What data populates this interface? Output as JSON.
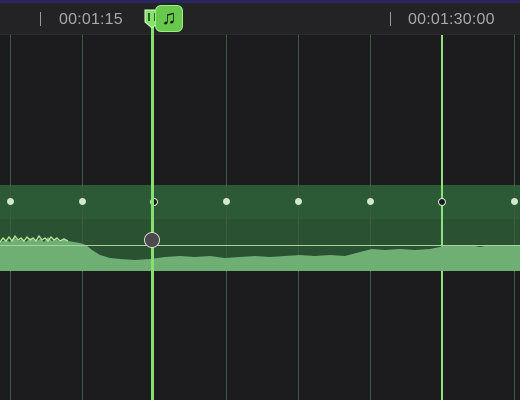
{
  "ruler": {
    "timecodes": [
      {
        "label": "00:01:15"
      },
      {
        "label": "00:01:30:00"
      }
    ]
  },
  "marker": {
    "icon": "music-note-icon",
    "glyph": "♫"
  },
  "playhead": {
    "icon": "playhead-icon"
  },
  "colors": {
    "accent": "#86e06d",
    "clip": "#2d5a36",
    "waveform": "#6faf74",
    "background": "#1c1c1e"
  }
}
